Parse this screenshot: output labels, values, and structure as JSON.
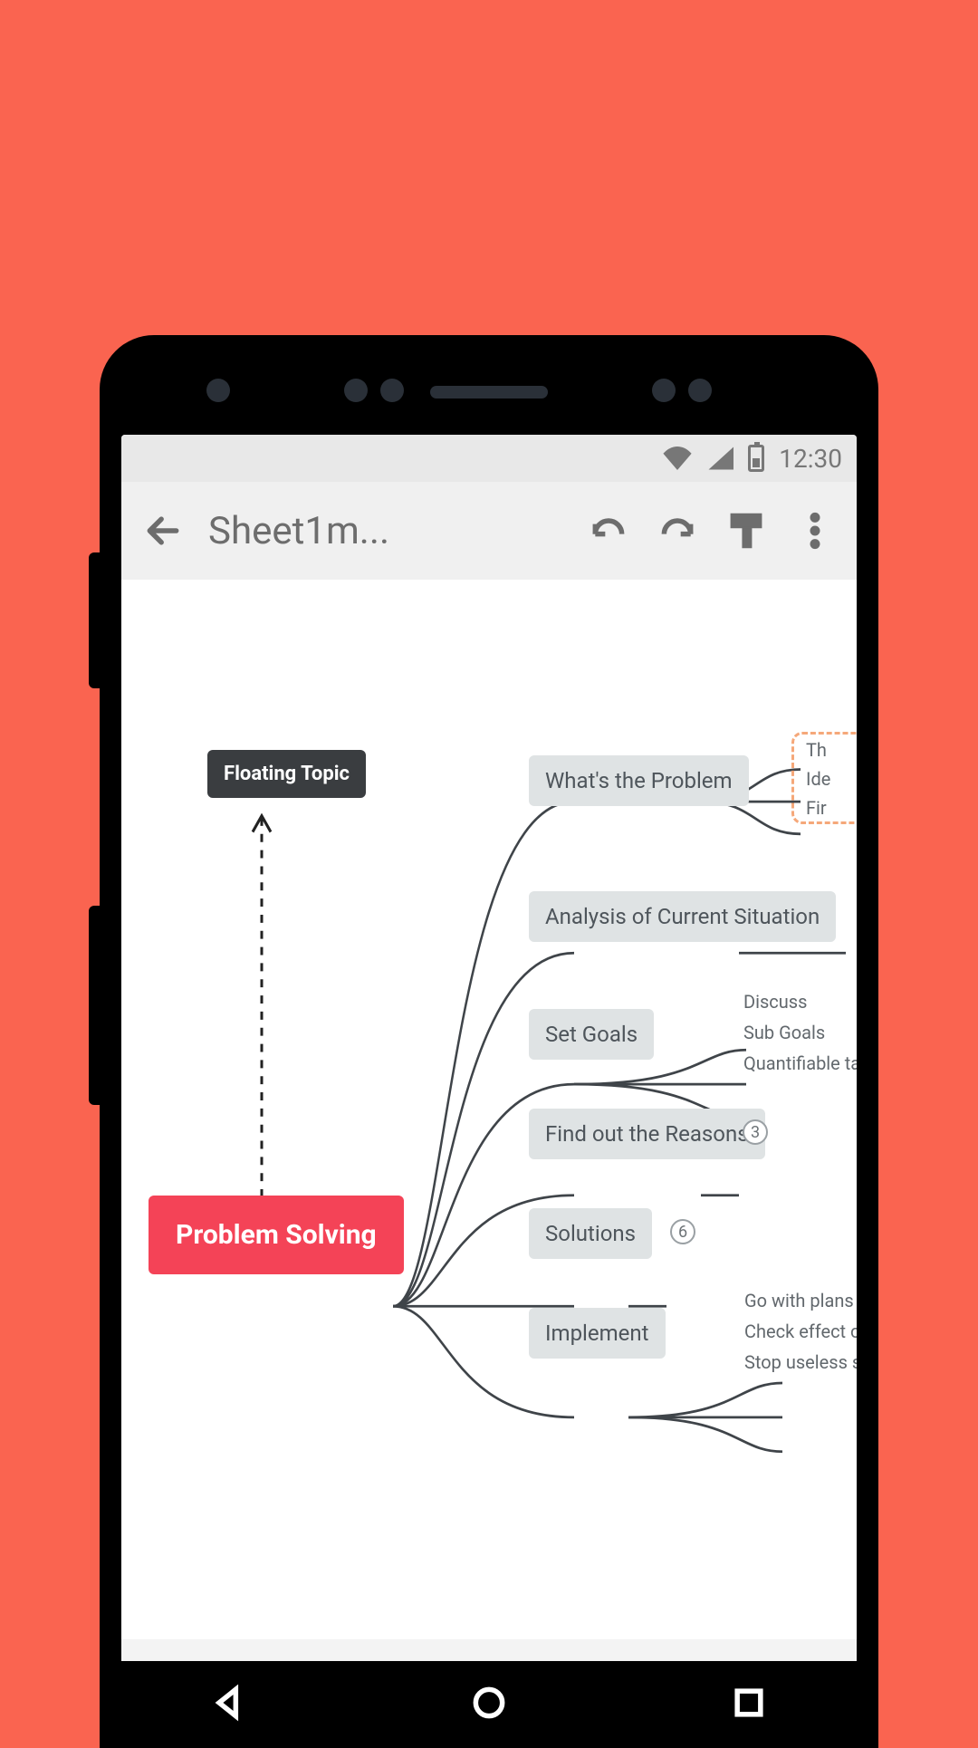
{
  "statusbar": {
    "time": "12:30"
  },
  "toolbar": {
    "title": "Sheet1m..."
  },
  "mindmap": {
    "floating": "Floating Topic",
    "root": "Problem Solving",
    "b1": {
      "label": "What's the Problem",
      "sub1": "Th",
      "sub2": "Ide",
      "sub3": "Fir"
    },
    "b2": {
      "label": "Analysis of Current Situation"
    },
    "b3": {
      "label": "Set Goals",
      "sub1": "Discuss",
      "sub2": "Sub Goals",
      "sub3": "Quantifiable targe"
    },
    "b4": {
      "label": "Find out the Reasons",
      "badge": "3"
    },
    "b5": {
      "label": "Solutions",
      "badge": "6"
    },
    "b6": {
      "label": "Implement",
      "sub1": "Go with plans",
      "sub2": "Check effect of",
      "sub3": "Stop useless so"
    }
  }
}
